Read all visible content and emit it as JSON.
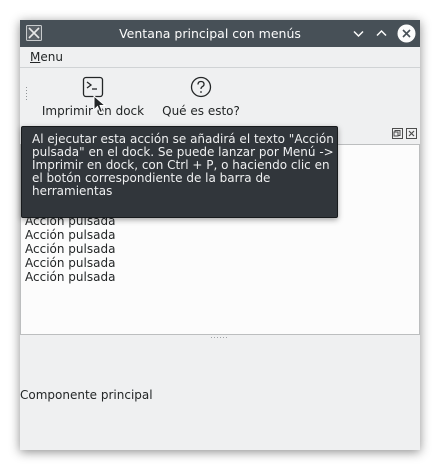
{
  "window": {
    "title": "Ventana principal con menús",
    "colors": {
      "titlebar": "#475057",
      "window_bg": "#eff0f1",
      "tooltip_bg": "#31363b"
    }
  },
  "titlebar_buttons": {
    "minimize_icon": "chevron-down-icon",
    "maximize_icon": "chevron-up-icon",
    "close_icon": "close-circle-icon"
  },
  "menubar": {
    "items": [
      {
        "mnemonic": "M",
        "rest": "enu"
      }
    ]
  },
  "toolbar": {
    "items": [
      {
        "label": "Imprimir en dock",
        "icon": "terminal-icon"
      },
      {
        "label": "Qué es esto?",
        "icon": "help-icon"
      }
    ]
  },
  "dock": {
    "lines": [
      "Acción pulsada",
      "Acción pulsada",
      "Acción pulsada",
      "Acción pulsada",
      "Acción pulsada"
    ]
  },
  "central": {
    "label": "Componente principal"
  },
  "tooltip": {
    "lines": [
      "Al ejecutar esta acción se añadirá el texto \"Acción",
      "pulsada\" en el dock. Se puede lanzar por Menú ->",
      "Imprimir en dock, con Ctrl + P, o haciendo clic en",
      "el botón correspondiente de la barra de",
      "herramientas"
    ]
  }
}
